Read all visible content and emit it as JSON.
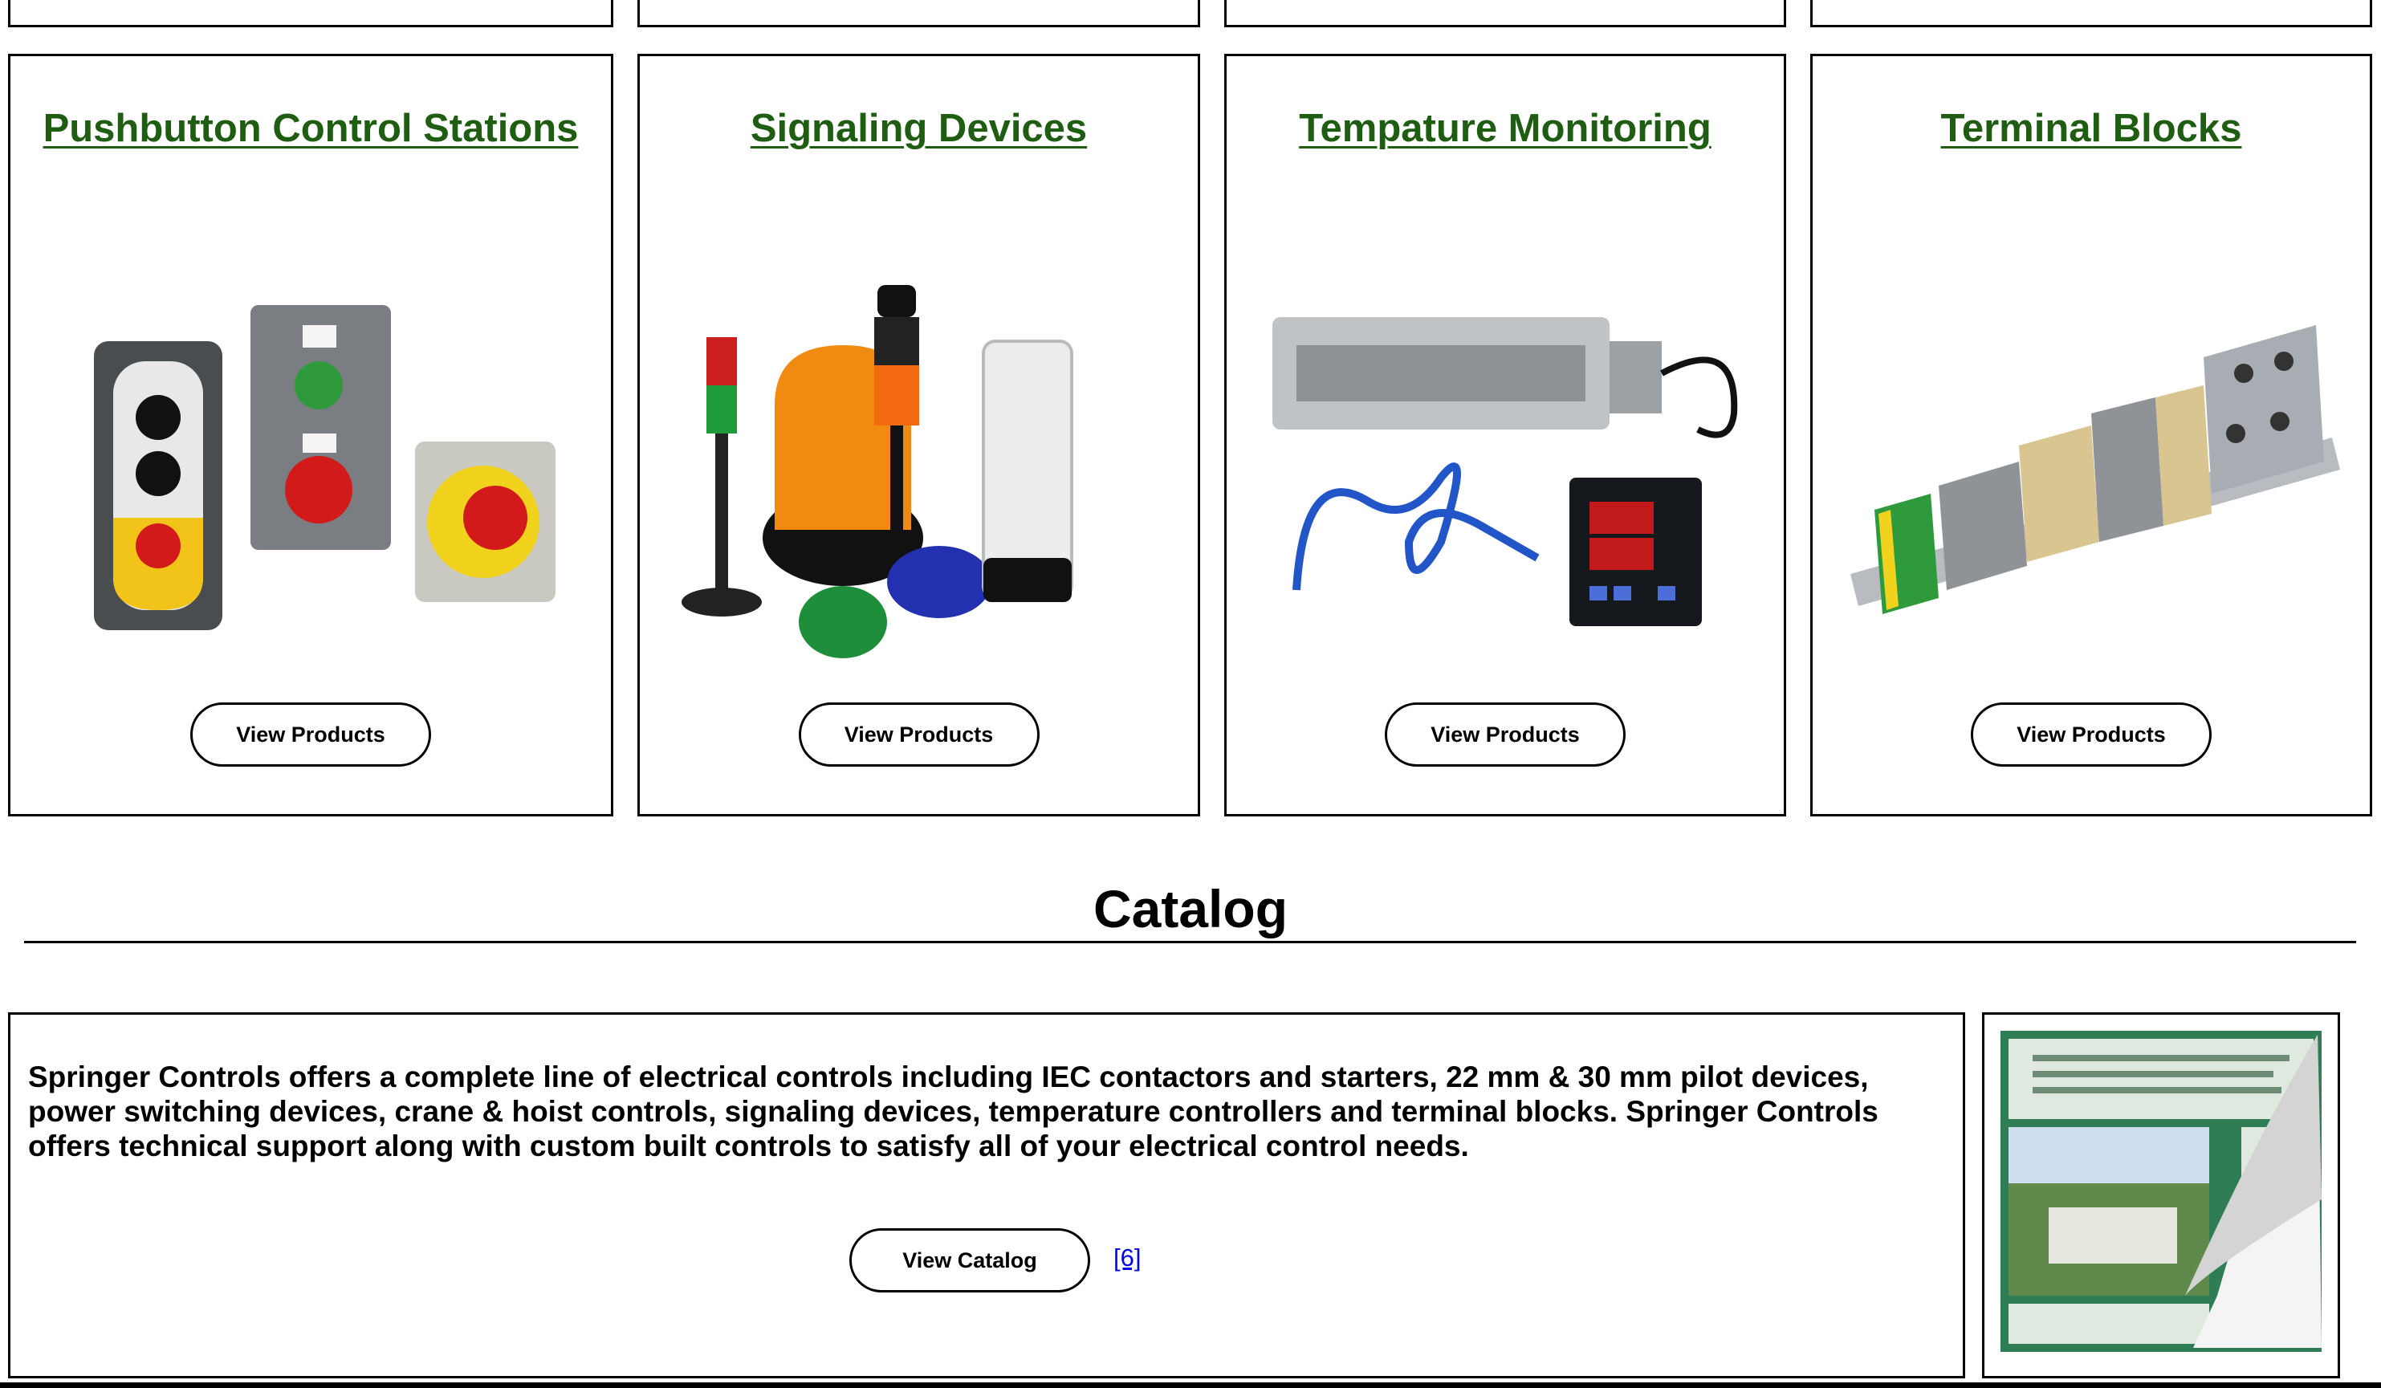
{
  "products": [
    {
      "title": "Pushbutton Control Stations",
      "button": "View Products",
      "image_icon": "pushbutton-stations-image"
    },
    {
      "title": "Signaling Devices",
      "button": "View Products",
      "image_icon": "signaling-devices-image"
    },
    {
      "title": "Tempature Monitoring",
      "button": "View Products",
      "image_icon": "temperature-monitoring-image"
    },
    {
      "title": "Terminal Blocks",
      "button": "View Products",
      "image_icon": "terminal-blocks-image"
    }
  ],
  "catalog": {
    "heading": "Catalog",
    "description": "Springer Controls offers a complete line of electrical controls including IEC contactors and starters, 22 mm & 30 mm pilot devices, power switching devices, crane & hoist controls, signaling devices, temperature controllers and terminal blocks. Springer Controls offers technical support along with custom built controls to satisfy all of your electrical control needs.",
    "button": "View Catalog",
    "ref_link": "[6]",
    "thumbnail_icon": "catalog-cover-image"
  },
  "colors": {
    "title_green": "#1f5d12",
    "link_blue": "#0000ee",
    "border": "#000000"
  }
}
